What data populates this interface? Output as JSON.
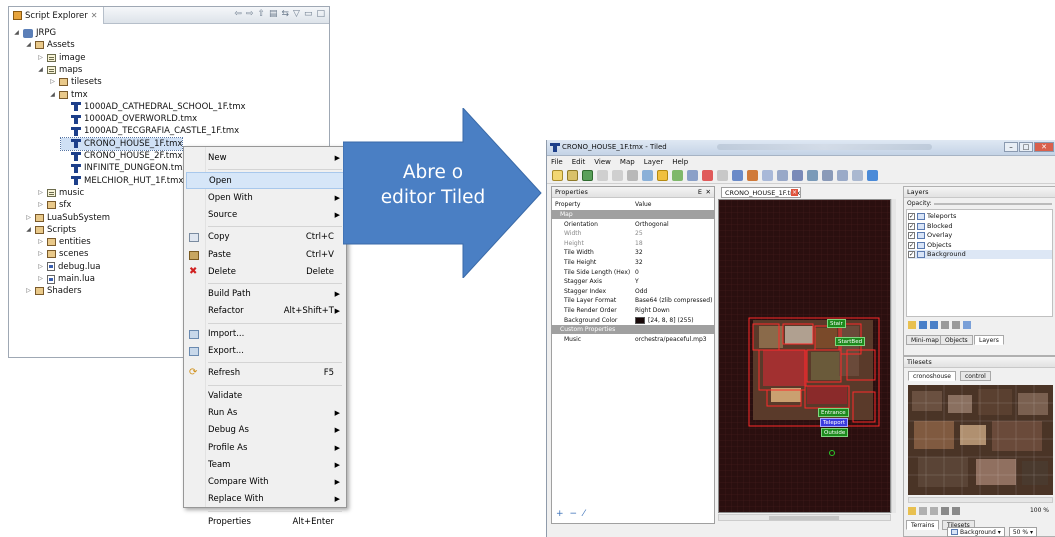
{
  "explorer": {
    "tab_label": "Script Explorer",
    "tree": [
      {
        "label": "JRPG",
        "depth": 0,
        "icon": "project-icon",
        "expanded": true
      },
      {
        "label": "Assets",
        "depth": 1,
        "icon": "package-icon",
        "expanded": true
      },
      {
        "label": "image",
        "depth": 2,
        "icon": "folder-icon",
        "expanded": false
      },
      {
        "label": "maps",
        "depth": 2,
        "icon": "folder-icon",
        "expanded": true
      },
      {
        "label": "tilesets",
        "depth": 3,
        "icon": "package-icon",
        "expanded": false
      },
      {
        "label": "tmx",
        "depth": 3,
        "icon": "package-icon",
        "expanded": true
      },
      {
        "label": "1000AD_CATHEDRAL_SCHOOL_1F.tmx",
        "depth": 4,
        "icon": "tiled-file-icon"
      },
      {
        "label": "1000AD_OVERWORLD.tmx",
        "depth": 4,
        "icon": "tiled-file-icon"
      },
      {
        "label": "1000AD_TECGRAFIA_CASTLE_1F.tmx",
        "depth": 4,
        "icon": "tiled-file-icon"
      },
      {
        "label": "CRONO_HOUSE_1F.tmx",
        "depth": 4,
        "icon": "tiled-file-icon",
        "selected": true
      },
      {
        "label": "CRONO_HOUSE_2F.tmx",
        "depth": 4,
        "icon": "tiled-file-icon"
      },
      {
        "label": "INFINITE_DUNGEON.tmx",
        "depth": 4,
        "icon": "tiled-file-icon"
      },
      {
        "label": "MELCHIOR_HUT_1F.tmx",
        "depth": 4,
        "icon": "tiled-file-icon"
      },
      {
        "label": "music",
        "depth": 2,
        "icon": "folder-icon",
        "expanded": false
      },
      {
        "label": "sfx",
        "depth": 2,
        "icon": "package-icon",
        "expanded": false
      },
      {
        "label": "LuaSubSystem",
        "depth": 1,
        "icon": "package-icon",
        "expanded": false
      },
      {
        "label": "Scripts",
        "depth": 1,
        "icon": "package-icon",
        "expanded": true
      },
      {
        "label": "entities",
        "depth": 2,
        "icon": "package-icon",
        "expanded": false
      },
      {
        "label": "scenes",
        "depth": 2,
        "icon": "package-icon",
        "expanded": false
      },
      {
        "label": "debug.lua",
        "depth": 2,
        "icon": "lua-file-icon",
        "expanded": false
      },
      {
        "label": "main.lua",
        "depth": 2,
        "icon": "lua-file-icon",
        "expanded": false
      },
      {
        "label": "Shaders",
        "depth": 1,
        "icon": "package-icon",
        "expanded": false
      }
    ]
  },
  "context_menu": {
    "items": [
      {
        "label": "New",
        "shortcut": "",
        "submenu": true,
        "icon": ""
      },
      {
        "sep": true
      },
      {
        "label": "Open",
        "shortcut": "",
        "submenu": false,
        "icon": "",
        "highlight": true
      },
      {
        "label": "Open With",
        "shortcut": "",
        "submenu": true,
        "icon": ""
      },
      {
        "label": "Source",
        "shortcut": "",
        "submenu": true,
        "icon": ""
      },
      {
        "sep": true
      },
      {
        "label": "Copy",
        "shortcut": "Ctrl+C",
        "submenu": false,
        "icon": "copy-icon"
      },
      {
        "label": "Paste",
        "shortcut": "Ctrl+V",
        "submenu": false,
        "icon": "paste-icon"
      },
      {
        "label": "Delete",
        "shortcut": "Delete",
        "submenu": false,
        "icon": "delete-icon"
      },
      {
        "sep": true
      },
      {
        "label": "Build Path",
        "shortcut": "",
        "submenu": true,
        "icon": ""
      },
      {
        "label": "Refactor",
        "shortcut": "Alt+Shift+T",
        "submenu": true,
        "icon": ""
      },
      {
        "sep": true
      },
      {
        "label": "Import...",
        "shortcut": "",
        "submenu": false,
        "icon": "import-icon"
      },
      {
        "label": "Export...",
        "shortcut": "",
        "submenu": false,
        "icon": "export-icon"
      },
      {
        "sep": true
      },
      {
        "label": "Refresh",
        "shortcut": "F5",
        "submenu": false,
        "icon": "refresh-icon"
      },
      {
        "sep": true
      },
      {
        "label": "Validate",
        "shortcut": "",
        "submenu": false,
        "icon": ""
      },
      {
        "label": "Run As",
        "shortcut": "",
        "submenu": true,
        "icon": ""
      },
      {
        "label": "Debug As",
        "shortcut": "",
        "submenu": true,
        "icon": ""
      },
      {
        "label": "Profile As",
        "shortcut": "",
        "submenu": true,
        "icon": ""
      },
      {
        "label": "Team",
        "shortcut": "",
        "submenu": true,
        "icon": ""
      },
      {
        "label": "Compare With",
        "shortcut": "",
        "submenu": true,
        "icon": ""
      },
      {
        "label": "Replace With",
        "shortcut": "",
        "submenu": true,
        "icon": ""
      },
      {
        "sep": true
      },
      {
        "label": "Properties",
        "shortcut": "Alt+Enter",
        "submenu": false,
        "icon": ""
      }
    ]
  },
  "arrow": {
    "line1": "Abre o",
    "line2": "editor Tiled",
    "color": "#4a7fc4"
  },
  "tiled": {
    "title": "CRONO_HOUSE_1F.tmx - Tiled",
    "menu": [
      "File",
      "Edit",
      "View",
      "Map",
      "Layer",
      "Help"
    ],
    "properties_title": "Properties",
    "prop_col_property": "Property",
    "prop_col_value": "Value",
    "properties": [
      {
        "k": "Map",
        "v": "",
        "group": true
      },
      {
        "k": "Orientation",
        "v": "Orthogonal"
      },
      {
        "k": "Width",
        "v": "25",
        "dim": true
      },
      {
        "k": "Height",
        "v": "18",
        "dim": true
      },
      {
        "k": "Tile Width",
        "v": "32"
      },
      {
        "k": "Tile Height",
        "v": "32"
      },
      {
        "k": "Tile Side Length (Hex)",
        "v": "0"
      },
      {
        "k": "Stagger Axis",
        "v": "Y"
      },
      {
        "k": "Stagger Index",
        "v": "Odd"
      },
      {
        "k": "Tile Layer Format",
        "v": "Base64 (zlib compressed)"
      },
      {
        "k": "Tile Render Order",
        "v": "Right Down"
      },
      {
        "k": "Background Color",
        "v": "[24, 8, 8] (255)"
      },
      {
        "k": "Custom Properties",
        "v": "",
        "group": true
      },
      {
        "k": "Music",
        "v": "orchestra/peaceful.mp3"
      }
    ],
    "doc_tab": "CRONO_HOUSE_1F.tmx",
    "map_tags": [
      {
        "label": "Stair",
        "blue": false
      },
      {
        "label": "StartBed",
        "blue": false
      },
      {
        "label": "Entrance",
        "blue": false
      },
      {
        "label": "Teleport",
        "blue": true
      },
      {
        "label": "Outside",
        "blue": false
      }
    ],
    "layers_title": "Layers",
    "opacity_label": "Opacity:",
    "layers": [
      {
        "label": "Teleports",
        "checked": true
      },
      {
        "label": "Blocked",
        "checked": true
      },
      {
        "label": "Overlay",
        "checked": true
      },
      {
        "label": "Objects",
        "checked": true
      },
      {
        "label": "Background",
        "checked": true,
        "selected": true
      }
    ],
    "layer_tabs": [
      "Mini-map",
      "Objects",
      "Layers"
    ],
    "tilesets_title": "Tilesets",
    "tileset_tabs": [
      "cronoshouse",
      "control"
    ],
    "tileset_zoom": "100 %",
    "bottom_tabs": [
      "Terrains",
      "Tilesets"
    ],
    "status_layer": "Background",
    "status_zoom": "50 %"
  }
}
